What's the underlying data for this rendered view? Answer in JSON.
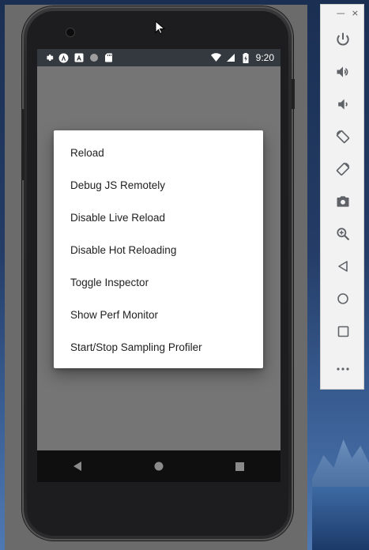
{
  "status_bar": {
    "time": "9:20",
    "left_icons": [
      "settings-icon",
      "android-studio-icon",
      "a-icon",
      "circle-icon",
      "sd-card-icon"
    ],
    "right_icons": [
      "wifi-icon",
      "cell-signal-icon",
      "battery-charging-icon"
    ]
  },
  "dev_menu": {
    "items": [
      {
        "label": "Reload"
      },
      {
        "label": "Debug JS Remotely"
      },
      {
        "label": "Disable Live Reload"
      },
      {
        "label": "Disable Hot Reloading"
      },
      {
        "label": "Toggle Inspector"
      },
      {
        "label": "Show Perf Monitor"
      },
      {
        "label": "Start/Stop Sampling Profiler"
      }
    ]
  },
  "nav_bar": {
    "buttons": [
      "back-icon",
      "home-icon",
      "overview-icon"
    ]
  },
  "emulator_toolbar": {
    "window_controls": [
      "—",
      "×"
    ],
    "buttons": [
      "power-icon",
      "volume-up-icon",
      "volume-down-icon",
      "rotate-left-icon",
      "rotate-right-icon",
      "camera-icon",
      "zoom-icon",
      "back-icon",
      "home-icon",
      "overview-icon",
      "more-icon"
    ]
  },
  "colors": {
    "screen_bg": "#757575",
    "dialog_bg": "#ffffff",
    "status_bar": "#34393f",
    "toolbar_icon": "#5f6368"
  }
}
